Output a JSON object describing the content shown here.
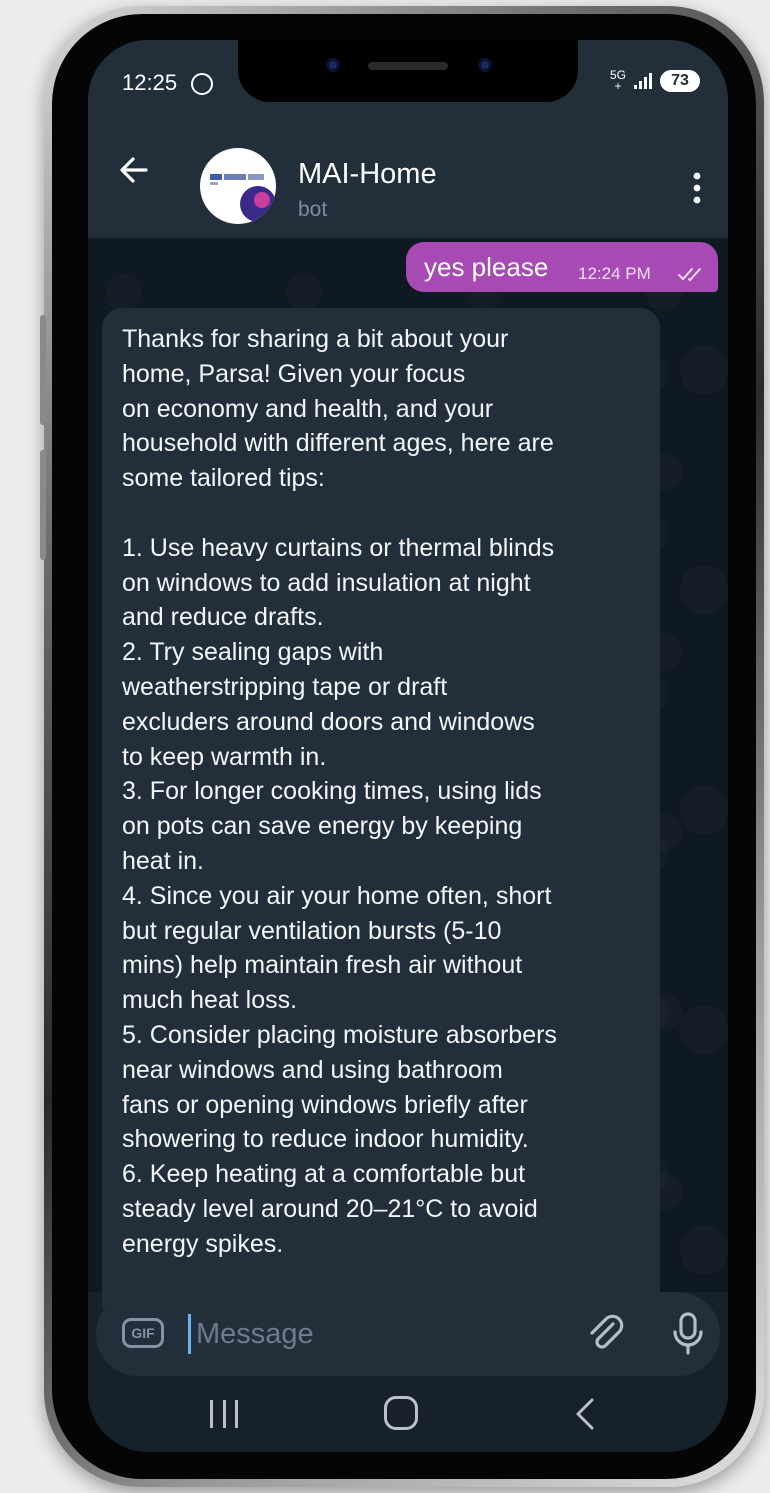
{
  "status_bar": {
    "time": "12:25",
    "network_top": "5G",
    "network_bottom": "+",
    "battery": "73"
  },
  "header": {
    "contact_name": "MAI-Home",
    "contact_subtitle": "bot"
  },
  "messages": [
    {
      "direction": "outgoing",
      "text": "yes please",
      "time": "12:24 PM",
      "status": "read"
    },
    {
      "direction": "incoming",
      "text": "Thanks for sharing a bit about your\nhome, Parsa! Given your focus\non economy and health, and your\nhousehold with different ages, here are\nsome tailored tips:\n\n1. Use heavy curtains or thermal blinds\non windows to add insulation at night\nand reduce drafts.\n2. Try sealing gaps with\nweatherstripping tape or draft\nexcluders around doors and windows\nto keep warmth in.\n3. For longer cooking times, using lids\non pots can save energy by keeping\nheat in.\n4. Since you air your home often, short\nbut regular ventilation bursts (5-10\nmins) help maintain fresh air without\nmuch heat loss.\n5. Consider placing moisture absorbers\nnear windows and using bathroom\nfans or opening windows briefly after\nshowering to reduce indoor humidity.\n6. Keep heating at a comfortable but\nsteady level around 20–21°C to avoid\nenergy spikes.\n\nWould you like tips specific to kitchen"
    }
  ],
  "composer": {
    "gif_label": "GIF",
    "placeholder": "Message"
  },
  "colors": {
    "outgoing_bubble": "#a74ab3",
    "incoming_bubble": "#222e3a",
    "header_bg": "#222e3a",
    "chat_bg": "#0f1921",
    "accent_caret": "#6ab3f3"
  },
  "icons": {
    "back": "arrow-left-icon",
    "menu": "more-vertical-icon",
    "attach": "paperclip-icon",
    "mic": "microphone-icon",
    "read_status": "double-check-icon"
  }
}
